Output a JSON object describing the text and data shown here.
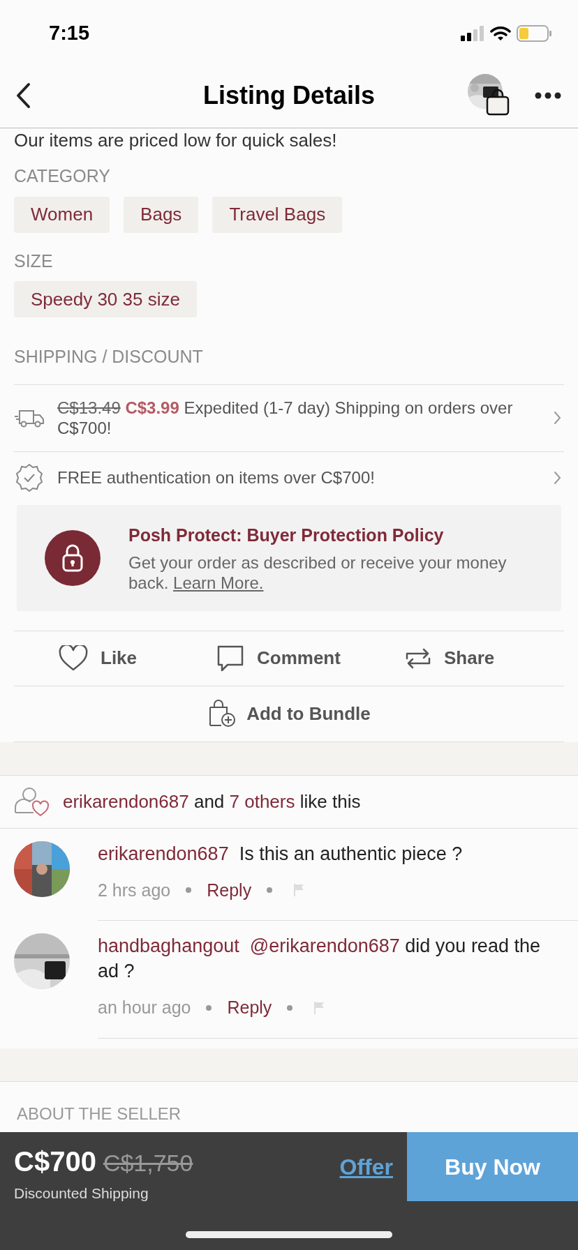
{
  "status_bar": {
    "time": "7:15"
  },
  "header": {
    "title": "Listing Details"
  },
  "description_tail": "Our items are priced low for quick sales!",
  "category": {
    "label": "CATEGORY",
    "chips": [
      "Women",
      "Bags",
      "Travel Bags"
    ]
  },
  "size": {
    "label": "SIZE",
    "chips": [
      "Speedy 30 35 size"
    ]
  },
  "shipping": {
    "label": "SHIPPING / DISCOUNT",
    "rows": [
      {
        "kind": "shipping",
        "old_price": "C$13.49",
        "new_price": "C$3.99",
        "text": "Expedited (1-7 day) Shipping on orders over C$700!"
      },
      {
        "kind": "authentication",
        "text": "FREE authentication on items over C$700!"
      }
    ]
  },
  "protection": {
    "title": "Posh Protect: Buyer Protection Policy",
    "body": "Get your order as described or receive your money back.",
    "link": "Learn More."
  },
  "actions": [
    {
      "kind": "like",
      "label": "Like"
    },
    {
      "kind": "comment",
      "label": "Comment"
    },
    {
      "kind": "share",
      "label": "Share"
    }
  ],
  "bundle": {
    "label": "Add to Bundle"
  },
  "likes": {
    "user": "erikarendon687",
    "middle": "and",
    "others": "7 others",
    "tail": "like this"
  },
  "comments": [
    {
      "user": "erikarendon687",
      "text": "Is this an authentic piece ?",
      "time": "2 hrs ago",
      "reply": "Reply"
    },
    {
      "user": "handbaghangout",
      "mention": "@erikarendon687",
      "text": "did you read the ad ?",
      "time": "an hour ago",
      "reply": "Reply"
    }
  ],
  "about_label": "ABOUT THE SELLER",
  "buy_bar": {
    "price": "C$700",
    "original_price": "C$1,750",
    "note": "Discounted Shipping",
    "offer": "Offer",
    "buy": "Buy Now"
  }
}
